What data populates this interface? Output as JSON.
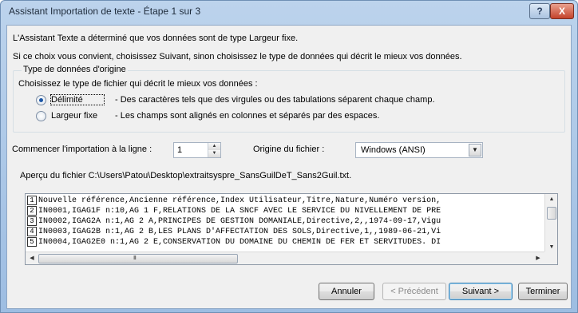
{
  "window": {
    "title": "Assistant Importation de texte - Étape 1 sur 3",
    "help_button": "?",
    "close_button": "X"
  },
  "intro": {
    "line1": "L'Assistant Texte a déterminé que vos données sont de type Largeur fixe.",
    "line2": "Si ce choix vous convient, choisissez Suivant, sinon choisissez le type de données qui décrit le mieux vos données."
  },
  "data_type": {
    "group_title": "Type de données d'origine",
    "instruction": "Choisissez le type de fichier qui décrit le mieux vos données :",
    "options": [
      {
        "label": "Délimité",
        "description": "- Des caractères tels que des virgules ou des tabulations séparent chaque champ.",
        "checked": true
      },
      {
        "label": "Largeur fixe",
        "description": "- Les champs sont alignés en colonnes et séparés par des espaces.",
        "checked": false
      }
    ]
  },
  "start_row": {
    "label": "Commencer l'importation à la ligne :",
    "value": "1"
  },
  "file_origin": {
    "label": "Origine du fichier :",
    "value": "Windows (ANSI)"
  },
  "preview": {
    "label": "Aperçu du fichier C:\\Users\\Patou\\Desktop\\extraitsyspre_SansGuilDeT_Sans2Guil.txt.",
    "rows": [
      {
        "num": "1",
        "text": "Nouvelle référence,Ancienne référence,Index Utilisateur,Titre,Nature,Numéro version,"
      },
      {
        "num": "2",
        "text": "IN0001,IGAG1F n:10,AG 1 F,RELATIONS DE LA SNCF AVEC LE SERVICE DU NIVELLEMENT DE PRE"
      },
      {
        "num": "3",
        "text": "IN0002,IGAG2A n:1,AG 2 A,PRINCIPES DE GESTION DOMANIALE,Directive,2,,1974-09-17,Vigu"
      },
      {
        "num": "4",
        "text": "IN0003,IGAG2B n:1,AG 2 B,LES PLANS D'AFFECTATION DES SOLS,Directive,1,,1989-06-21,Vi"
      },
      {
        "num": "5",
        "text": "IN0004,IGAG2E0 n:1,AG 2 E,CONSERVATION DU DOMAINE DU CHEMIN DE FER ET SERVITUDES. DI"
      }
    ],
    "scroll_grip": "III"
  },
  "buttons": {
    "cancel": "Annuler",
    "previous": "< Précédent",
    "next": "Suivant >",
    "finish": "Terminer"
  },
  "colors": {
    "title_gradient_top": "#bcd3ec",
    "dialog_bg": "#f0f0f0",
    "close_red": "#c4432b"
  }
}
